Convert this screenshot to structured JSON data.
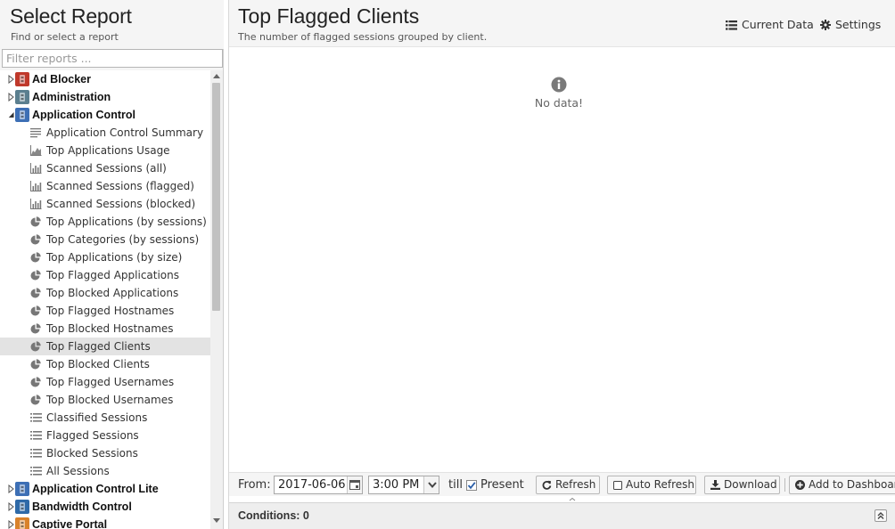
{
  "left_panel": {
    "title": "Select Report",
    "subtitle": "Find or select a report",
    "filter_placeholder": "Filter reports ..."
  },
  "tree": [
    {
      "type": "category",
      "label": "Ad Blocker",
      "expanded": false,
      "icon": "ad-blocker-icon",
      "color": "#c0392b"
    },
    {
      "type": "category",
      "label": "Administration",
      "expanded": false,
      "icon": "administration-icon",
      "color": "#5b7f8f"
    },
    {
      "type": "category",
      "label": "Application Control",
      "expanded": true,
      "icon": "application-control-icon",
      "color": "#3d6fb5"
    },
    {
      "type": "report",
      "label": "Application Control Summary",
      "icon": "text-lines-icon"
    },
    {
      "type": "report",
      "label": "Top Applications Usage",
      "icon": "area-chart-icon"
    },
    {
      "type": "report",
      "label": "Scanned Sessions (all)",
      "icon": "bar-chart-icon"
    },
    {
      "type": "report",
      "label": "Scanned Sessions (flagged)",
      "icon": "bar-chart-icon"
    },
    {
      "type": "report",
      "label": "Scanned Sessions (blocked)",
      "icon": "bar-chart-icon"
    },
    {
      "type": "report",
      "label": "Top Applications (by sessions)",
      "icon": "pie-chart-icon"
    },
    {
      "type": "report",
      "label": "Top Categories (by sessions)",
      "icon": "pie-chart-icon"
    },
    {
      "type": "report",
      "label": "Top Applications (by size)",
      "icon": "pie-chart-icon"
    },
    {
      "type": "report",
      "label": "Top Flagged Applications",
      "icon": "pie-chart-icon"
    },
    {
      "type": "report",
      "label": "Top Blocked Applications",
      "icon": "pie-chart-icon"
    },
    {
      "type": "report",
      "label": "Top Flagged Hostnames",
      "icon": "pie-chart-icon"
    },
    {
      "type": "report",
      "label": "Top Blocked Hostnames",
      "icon": "pie-chart-icon"
    },
    {
      "type": "report",
      "label": "Top Flagged Clients",
      "icon": "pie-chart-icon",
      "selected": true
    },
    {
      "type": "report",
      "label": "Top Blocked Clients",
      "icon": "pie-chart-icon"
    },
    {
      "type": "report",
      "label": "Top Flagged Usernames",
      "icon": "pie-chart-icon"
    },
    {
      "type": "report",
      "label": "Top Blocked Usernames",
      "icon": "pie-chart-icon"
    },
    {
      "type": "report",
      "label": "Classified Sessions",
      "icon": "list-icon"
    },
    {
      "type": "report",
      "label": "Flagged Sessions",
      "icon": "list-icon"
    },
    {
      "type": "report",
      "label": "Blocked Sessions",
      "icon": "list-icon"
    },
    {
      "type": "report",
      "label": "All Sessions",
      "icon": "list-icon"
    },
    {
      "type": "category",
      "label": "Application Control Lite",
      "expanded": false,
      "icon": "application-control-lite-icon",
      "color": "#3d6fb5"
    },
    {
      "type": "category",
      "label": "Bandwidth Control",
      "expanded": false,
      "icon": "bandwidth-control-icon",
      "color": "#2f6aa8"
    },
    {
      "type": "category",
      "label": "Captive Portal",
      "expanded": false,
      "icon": "captive-portal-icon",
      "color": "#d9822b"
    }
  ],
  "report": {
    "title": "Top Flagged Clients",
    "description": "The number of flagged sessions grouped by client.",
    "no_data": "No data!",
    "current_data_label": "Current Data",
    "settings_label": "Settings"
  },
  "toolbar": {
    "from_label": "From:",
    "from_date": "2017-06-06",
    "from_time": "3:00 PM",
    "till_label": "till",
    "present_label": "Present",
    "present_checked": true,
    "refresh_label": "Refresh",
    "auto_refresh_label": "Auto Refresh",
    "download_label": "Download",
    "add_to_dashboard_label": "Add to Dashboar"
  },
  "conditions": {
    "label": "Conditions: 0"
  }
}
